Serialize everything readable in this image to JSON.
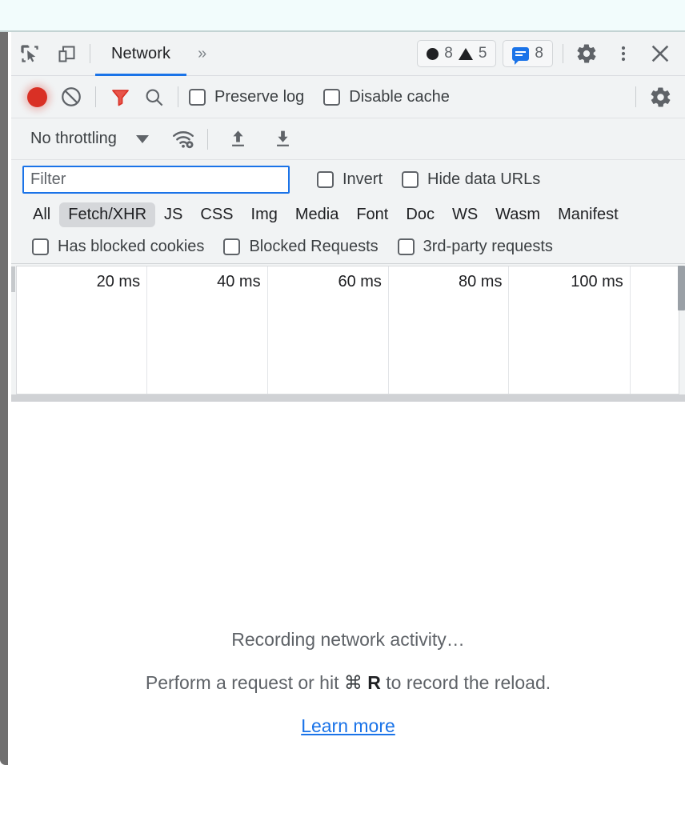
{
  "window": {
    "panel_title": "DevTools Network panel"
  },
  "tabbar": {
    "inspect_icon": "inspect-element-icon",
    "device_icon": "device-toolbar-icon",
    "tabs": [
      {
        "label": "Network",
        "active": true
      }
    ],
    "more_tabs_label": "»",
    "counters": {
      "errors_icon": "error-circle-icon",
      "errors_count": "8",
      "warnings_icon": "warning-triangle-icon",
      "warnings_count": "5",
      "messages_icon": "message-bubble-icon",
      "messages_count": "8"
    },
    "settings_icon": "gear-icon",
    "more_options_icon": "kebab-menu-icon",
    "close_icon": "close-icon"
  },
  "toolbar": {
    "record_icon": "record-button-icon",
    "record_state": "recording",
    "clear_icon": "clear-network-log-icon",
    "filter_icon": "filter-funnel-icon",
    "search_icon": "search-icon",
    "preserve_log": {
      "label": "Preserve log",
      "checked": false
    },
    "disable_cache": {
      "label": "Disable cache",
      "checked": false
    },
    "settings_icon": "network-settings-gear-icon"
  },
  "throttling": {
    "selected": "No throttling",
    "caret_icon": "chevron-down-icon",
    "wifi_icon": "wifi-settings-icon",
    "import_icon": "import-har-icon",
    "export_icon": "export-har-icon"
  },
  "filter": {
    "placeholder": "Filter",
    "value": "",
    "invert": {
      "label": "Invert",
      "checked": false
    },
    "hide_data_urls": {
      "label": "Hide data URLs",
      "checked": false
    }
  },
  "resource_types": [
    {
      "label": "All",
      "selected": false
    },
    {
      "label": "Fetch/XHR",
      "selected": true
    },
    {
      "label": "JS",
      "selected": false
    },
    {
      "label": "CSS",
      "selected": false
    },
    {
      "label": "Img",
      "selected": false
    },
    {
      "label": "Media",
      "selected": false
    },
    {
      "label": "Font",
      "selected": false
    },
    {
      "label": "Doc",
      "selected": false
    },
    {
      "label": "WS",
      "selected": false
    },
    {
      "label": "Wasm",
      "selected": false
    },
    {
      "label": "Manifest",
      "selected": false
    }
  ],
  "request_filters": [
    {
      "label": "Has blocked cookies",
      "checked": false
    },
    {
      "label": "Blocked Requests",
      "checked": false
    },
    {
      "label": "3rd-party requests",
      "checked": false
    }
  ],
  "overview": {
    "ticks": [
      {
        "label": "20 ms",
        "x_pct": 19.6
      },
      {
        "label": "40 ms",
        "x_pct": 37.8
      },
      {
        "label": "60 ms",
        "x_pct": 56.1
      },
      {
        "label": "80 ms",
        "x_pct": 74.3
      },
      {
        "label": "100 ms",
        "x_pct": 92.6
      }
    ]
  },
  "empty_state": {
    "title": "Recording network activity…",
    "instruction_before": "Perform a request or hit ",
    "cmd_symbol": "⌘",
    "key": "R",
    "instruction_after": " to record the reload.",
    "link": "Learn more"
  },
  "colors": {
    "accent_blue": "#1a73e8",
    "record_red": "#d93025",
    "toolbar_bg": "#f1f3f4",
    "text_primary": "#202124",
    "text_secondary": "#5f6368"
  }
}
